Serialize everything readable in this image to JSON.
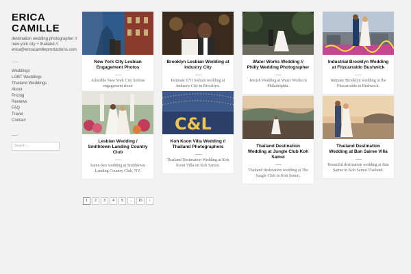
{
  "site": {
    "title_line1": "ERICA",
    "title_line2": "CAMILLE",
    "tagline": "destination wedding photographer // new york city + thailand // erica@ericacamilleproductions.com"
  },
  "menu": [
    "Weddings",
    "LGBT Weddings",
    "Thailand Weddings",
    "About",
    "Pricing",
    "Reviews",
    "FAQ",
    "Travel",
    "Contact"
  ],
  "search": {
    "placeholder": "Search ..."
  },
  "posts": [
    {
      "title": "New York City Lesbian Engagement Photos",
      "excerpt": "Adorable New York City lesbian engagement shoot"
    },
    {
      "title": "Brooklyn Lesbian Wedding at Industry City",
      "excerpt": "Intimate DYI lesbian wedding at Industry City in Brooklyn."
    },
    {
      "title": "Water Works Wedding // Philly Wedding Photographer",
      "excerpt": "Jewish Wedding at Water Works in Philadelphia."
    },
    {
      "title": "Industrial Brooklyn Wedding at Fitzcarraldo Bushwick",
      "excerpt": "Intimate Brooklyn wedding at the Fitzcarraldo in Bushwick."
    },
    {
      "title": "Lesbian Wedding / Smithtown Landing Country Club",
      "excerpt": "Same-Sex wedding at Smithtown Landing Country Club, NY."
    },
    {
      "title": "Koh Koon Villa Wedding // Thailand Photographers",
      "excerpt": "Thailand Destination Wedding at Koh Koon Villa on Koh Samui."
    },
    {
      "title": "Thailand Destination Wedding at Jungle Club Koh Samui",
      "excerpt": "Thailand destination wedding at The Jungle Club in Koh Samui."
    },
    {
      "title": "Thailand Destination Wedding at Ban Sairee Villa",
      "excerpt": "Beautiful destination wedding at Ban Sairee in Koh Samui Thailand."
    }
  ],
  "pagination": [
    "1",
    "2",
    "3",
    "4",
    "5",
    "...",
    "15",
    "›"
  ]
}
